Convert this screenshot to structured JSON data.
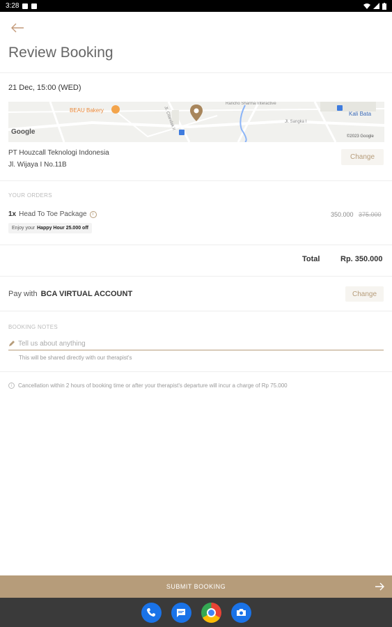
{
  "status": {
    "time": "3:28"
  },
  "header": {
    "title": "Review Booking"
  },
  "booking": {
    "datetime": "21 Dec, 15:00 (WED)",
    "map": {
      "place_bakery": "BEAU Bakery",
      "place_kalibata": "Kali Bata",
      "street_1": "Jl. Cilandak II",
      "street_2": "Jl. Sangka I",
      "top_text": "Rancho Sharma Interactive",
      "google": "Google",
      "copyright": "©2023 Google"
    },
    "location": {
      "name": "PT Houzcall Teknologi Indonesia",
      "address": "Jl. Wijaya I No.11B",
      "change_label": "Change"
    }
  },
  "orders": {
    "section_label": "YOUR ORDERS",
    "items": [
      {
        "qty": "1x",
        "name": "Head To Toe Package",
        "price": "350.000",
        "original_price": "375.000",
        "promo_prefix": "Enjoy your",
        "promo_bold": "Happy Hour 25.000 off"
      }
    ],
    "total_label": "Total",
    "total_value": "Rp. 350.000"
  },
  "payment": {
    "prefix": "Pay with",
    "method": "BCA VIRTUAL ACCOUNT",
    "change_label": "Change"
  },
  "notes": {
    "section_label": "BOOKING NOTES",
    "placeholder": "Tell us about anything",
    "helper": "This will be shared directly with our therapist's"
  },
  "cancellation": {
    "text": "Cancellation within 2 hours of booking time or after your therapist's departure will incur a charge of Rp 75.000"
  },
  "submit": {
    "label": "SUBMIT BOOKING"
  },
  "colors": {
    "accent": "#b69c7a",
    "nav_bar": "#3a3a3a"
  },
  "dock": {
    "icons": [
      "phone-icon",
      "messages-icon",
      "chrome-icon",
      "camera-icon"
    ]
  }
}
